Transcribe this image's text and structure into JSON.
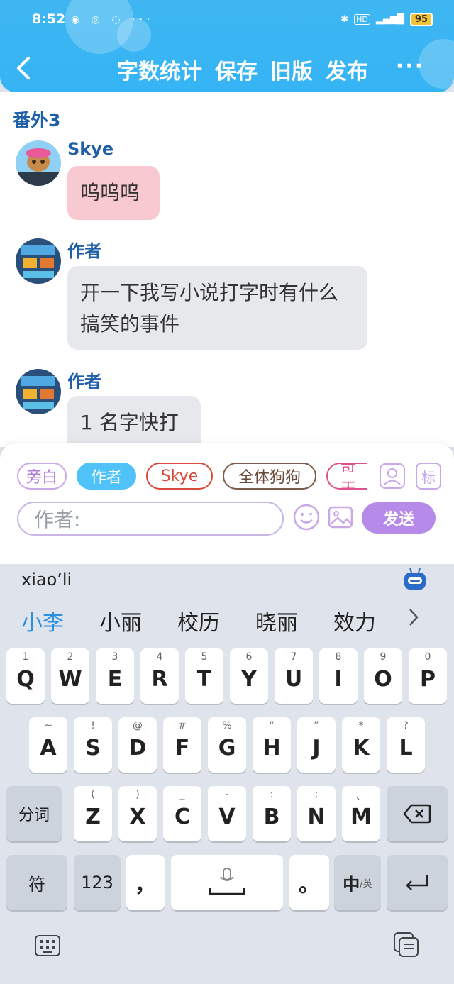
{
  "status_bar": {
    "time": "8:52",
    "battery": "95",
    "dots": "···"
  },
  "header": {
    "buttons": [
      "字数统计",
      "保存",
      "旧版",
      "发布"
    ],
    "more": "···"
  },
  "chat": {
    "chapter": "番外3",
    "messages": [
      {
        "name": "Skye",
        "text": "呜呜呜"
      },
      {
        "name": "作者",
        "text": "开一下我写小说打字时有什么搞笑的事件"
      },
      {
        "name": "作者",
        "text": "1 名字快打"
      }
    ]
  },
  "roles": {
    "chips": [
      "旁白",
      "作者",
      "Skye",
      "全体狗狗",
      "奇天"
    ],
    "tag_icon": "标"
  },
  "input": {
    "placeholder": "作者:",
    "send": "发送"
  },
  "keyboard": {
    "pinyin": "xiao’li",
    "candidates": [
      "小李",
      "小丽",
      "校历",
      "晓丽",
      "效力"
    ],
    "row1": [
      [
        "1",
        "Q"
      ],
      [
        "2",
        "W"
      ],
      [
        "3",
        "E"
      ],
      [
        "4",
        "R"
      ],
      [
        "5",
        "T"
      ],
      [
        "6",
        "Y"
      ],
      [
        "7",
        "U"
      ],
      [
        "8",
        "I"
      ],
      [
        "9",
        "O"
      ],
      [
        "0",
        "P"
      ]
    ],
    "row2": [
      [
        "~",
        "A"
      ],
      [
        "!",
        "S"
      ],
      [
        "@",
        "D"
      ],
      [
        "#",
        "F"
      ],
      [
        "%",
        "G"
      ],
      [
        "“",
        "H"
      ],
      [
        "”",
        "J"
      ],
      [
        "*",
        "K"
      ],
      [
        "?",
        "L"
      ]
    ],
    "row3": [
      [
        "(",
        "Z"
      ],
      [
        ")",
        "X"
      ],
      [
        "_",
        "C"
      ],
      [
        "-",
        "V"
      ],
      [
        ":",
        "B"
      ],
      [
        ";",
        "N"
      ],
      [
        "、",
        "M"
      ]
    ],
    "fenci": "分词",
    "fu": "符",
    "num": "123",
    "comma": "，",
    "period": "。",
    "zhong": "中",
    "ying": "/英"
  },
  "colors": {
    "header": "#3fb6f2",
    "name": "#1f5fa8",
    "send": "#b58ae8"
  }
}
